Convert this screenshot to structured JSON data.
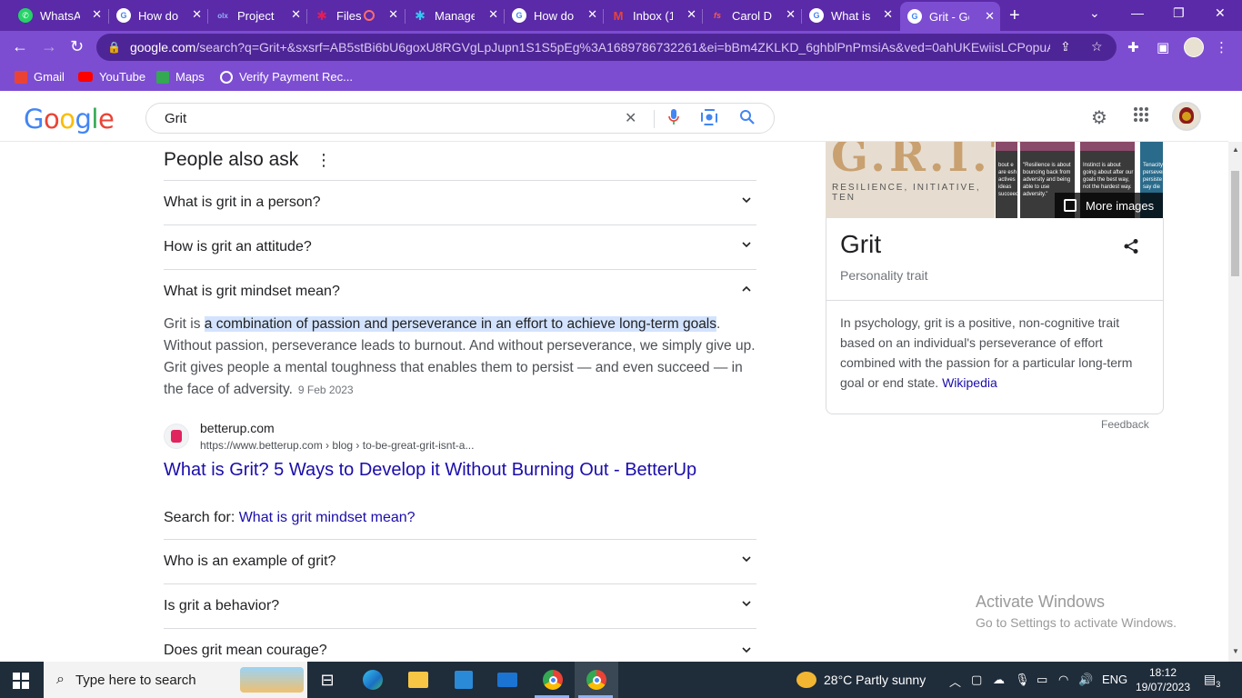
{
  "browser": {
    "tabs": [
      {
        "label": "WhatsApp",
        "icon": "whatsapp-icon",
        "color": "#25d366"
      },
      {
        "label": "How do",
        "icon": "google-icon",
        "color": "#ffffff"
      },
      {
        "label": "Project",
        "icon": "olx-icon",
        "color": "#3a77ff"
      },
      {
        "label": "Files",
        "icon": "slack-icon",
        "color": "#e01e5a",
        "recording": true
      },
      {
        "label": "Manage",
        "icon": "slack-icon",
        "color": "#36c5f0"
      },
      {
        "label": "How do",
        "icon": "google-icon",
        "color": "#ffffff"
      },
      {
        "label": "Inbox (1",
        "icon": "gmail-icon",
        "color": "#ea4335"
      },
      {
        "label": "Carol Dv",
        "icon": "fs-icon",
        "color": "#d93025"
      },
      {
        "label": "What is",
        "icon": "google-icon",
        "color": "#ffffff"
      },
      {
        "label": "Grit - Gc",
        "icon": "google-icon",
        "color": "#ffffff",
        "active": true
      }
    ],
    "url_host": "google.com",
    "url_rest": "/search?q=Grit+&sxsrf=AB5stBi6bU6goxU8RGVgLpJupn1S1S5pEg%3A1689786732261&ei=bBm4ZKLKD_6ghblPnPmsiAs&ved=0ahUKEwiisLCPopuAAx...",
    "bookmarks": [
      {
        "label": "Gmail",
        "icon": "gmail-icon",
        "color": "#ea4335"
      },
      {
        "label": "YouTube",
        "icon": "youtube-icon",
        "color": "#ff0000"
      },
      {
        "label": "Maps",
        "icon": "maps-icon",
        "color": "#34a853"
      },
      {
        "label": "Verify Payment Rec...",
        "icon": "globe-icon",
        "color": "#ffffff"
      }
    ]
  },
  "search": {
    "query": "Grit"
  },
  "paa": {
    "title": "People also ask",
    "q1": "What is grit in a person?",
    "q2": "How is grit an attitude?",
    "q3": "What is grit mindset mean?",
    "answer_start": "Grit is ",
    "answer_highlight": "a combination of passion and perseverance in an effort to achieve long-term goals",
    "answer_rest": ". Without passion, perseverance leads to burnout. And without perseverance, we simply give up. Grit gives people a mental toughness that enables them to persist — and even succeed — in the face of adversity.",
    "answer_date": "9 Feb 2023",
    "source_site": "betterup.com",
    "source_url": "https://www.betterup.com › blog › to-be-great-grit-isnt-a...",
    "source_title": "What is Grit? 5 Ways to Develop it Without Burning Out - BetterUp",
    "search_for_label": "Search for: ",
    "search_for_link": "What is grit mindset mean?",
    "q4": "Who is an example of grit?",
    "q5": "Is grit a behavior?",
    "q6": "Does grit mean courage?"
  },
  "knowledge": {
    "image_text_big": "G.R.I.T",
    "image_text_small": "RESILIENCE, INITIATIVE, TEN",
    "thumb1": "bout e are esh actives ideas succeed",
    "thumb2": "\"Resilience is about bouncing back from adversity and being able to use adversity.\"",
    "thumb3": "Instinct is about going about after our goals the best way, not the hardest way.",
    "thumb4": "Tenacity persevere persiste say die",
    "more_images": "More images",
    "title": "Grit",
    "subtitle": "Personality trait",
    "description": "In psychology, grit is a positive, non-cognitive trait based on an individual's perseverance of effort combined with the passion for a particular long-term goal or end state. ",
    "source": "Wikipedia",
    "feedback": "Feedback"
  },
  "watermark": {
    "line1": "Activate Windows",
    "line2": "Go to Settings to activate Windows."
  },
  "taskbar": {
    "search_placeholder": "Type here to search",
    "weather": "28°C  Partly sunny",
    "language": "ENG",
    "time": "18:12",
    "date": "19/07/2023",
    "notifications": "3"
  }
}
